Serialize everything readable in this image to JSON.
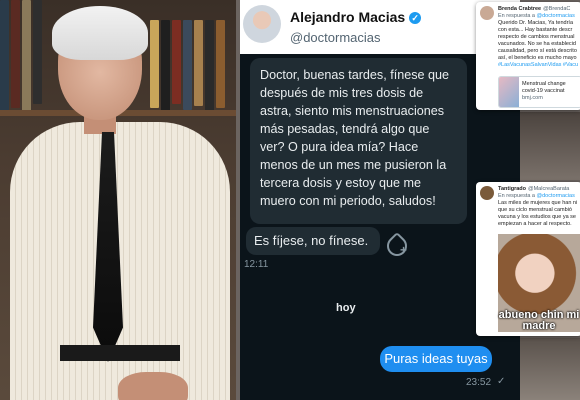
{
  "chat": {
    "profile": {
      "name": "Alejandro Macias",
      "handle": "@doctormacias"
    },
    "message_question": "Doctor, buenas tardes, fínese que después de mis tres dosis de astra, siento mis menstruaciones más pesadas, tendrá algo que ver? O pura idea mía? Hace menos de un mes me pusieron la tercera dosis y estoy que me muero con mi periodo, saludos!",
    "message_reply": "Es fíjese, no fínese.",
    "time_1": "12:11",
    "day_separator": "hoy",
    "message_out": "Puras ideas tuyas",
    "time_2": "23:52"
  },
  "card1": {
    "name": "Brenda Crabtree",
    "handle": "@BrendaC",
    "reply_prefix": "En respuesta a",
    "reply_handle": "@doctormacias",
    "lines": [
      "Querido Dr. Macias, Ya tendría",
      "con esta... Hay bastante descr",
      "respecto de cambios menstrual",
      "vacunados. No se ha establecid",
      "causalidad, pero sí está descrito",
      "así, el beneficio es mucho mayo"
    ],
    "hashtags": "#LasVacunasSalvanVidas #Vacu",
    "preview_title": "Menstrual change",
    "preview_sub": "covid-19 vaccinat",
    "preview_domain": "bmj.com"
  },
  "card2": {
    "name": "Tantigrado",
    "handle": "@MalcreaBarata",
    "reply_prefix": "En respuesta a",
    "reply_handle": "@doctormacias",
    "lines": [
      "Las miles de mujeres que han ni",
      "que su ciclo menstrual cambió",
      "vacuna y los estudios que ya se",
      "empiezan a hacer al respecto."
    ],
    "meme_text": "abueno chin mi madre"
  },
  "colors": {
    "chat_bg": "#0b141a",
    "bubble_in": "#202c33",
    "bubble_out": "#1f8ef0",
    "verified": "#1d9bf0"
  }
}
